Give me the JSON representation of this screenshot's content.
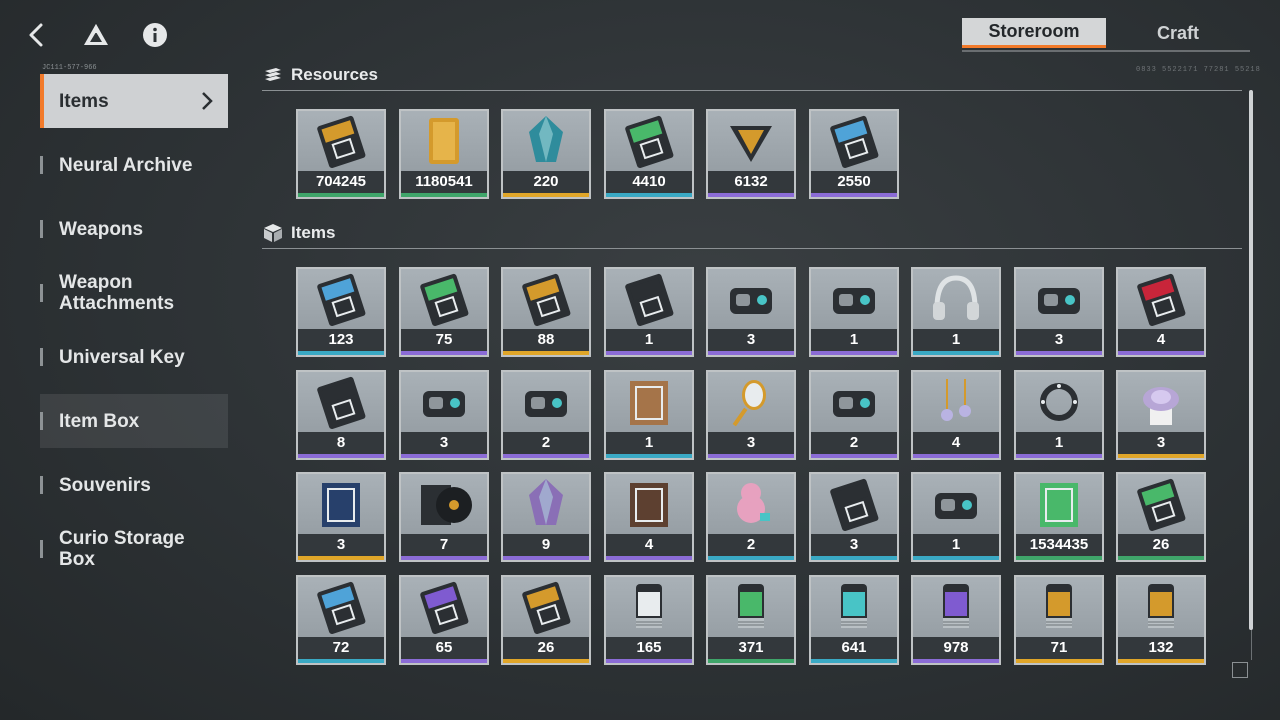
{
  "header": {
    "back_icon": "back-chevron-icon",
    "logo_icon": "triangle-logo-icon",
    "info_icon": "info-icon",
    "tabs": [
      {
        "label": "Storeroom",
        "active": true
      },
      {
        "label": "Craft",
        "active": false
      }
    ]
  },
  "serials": {
    "left": "JC111-577-966",
    "right": "0833 5522171 77281 55218"
  },
  "sidebar": {
    "items": [
      {
        "label": "Items",
        "selected": true
      },
      {
        "label": "Neural Archive"
      },
      {
        "label": "Weapons"
      },
      {
        "label": "Weapon Attachments"
      },
      {
        "label": "Universal Key"
      },
      {
        "label": "Item Box",
        "highlighted": true
      },
      {
        "label": "Souvenirs"
      },
      {
        "label": "Curio Storage Box"
      }
    ]
  },
  "colors": {
    "accent": "#f27a2a",
    "rarity_green": "#3fa56a",
    "rarity_gold": "#e0a629",
    "rarity_blue": "#3aa9c4",
    "rarity_purple": "#8b6cd6"
  },
  "resources": {
    "title": "Resources",
    "items": [
      {
        "qty": "704245",
        "rarity": "green",
        "icon": "gold-ticket-icon"
      },
      {
        "qty": "1180541",
        "rarity": "green",
        "icon": "gold-bar-icon"
      },
      {
        "qty": "220",
        "rarity": "gold",
        "icon": "crystal-gem-icon"
      },
      {
        "qty": "4410",
        "rarity": "blue",
        "icon": "green-ticket-icon"
      },
      {
        "qty": "6132",
        "rarity": "purple",
        "icon": "triangle-token-icon"
      },
      {
        "qty": "2550",
        "rarity": "purple",
        "icon": "blue-card-icon"
      }
    ]
  },
  "items": {
    "title": "Items",
    "rows": [
      [
        {
          "qty": "123",
          "rarity": "blue",
          "icon": "blue-chip-card-icon"
        },
        {
          "qty": "75",
          "rarity": "purple",
          "icon": "green-chip-card-icon"
        },
        {
          "qty": "88",
          "rarity": "gold",
          "icon": "gold-chip-card-icon"
        },
        {
          "qty": "1",
          "rarity": "purple",
          "icon": "black-card-icon"
        },
        {
          "qty": "3",
          "rarity": "purple",
          "icon": "camcorder-icon"
        },
        {
          "qty": "1",
          "rarity": "purple",
          "icon": "vr-headset-icon"
        },
        {
          "qty": "1",
          "rarity": "blue",
          "icon": "headphones-icon"
        },
        {
          "qty": "3",
          "rarity": "purple",
          "icon": "armored-vehicle-icon"
        },
        {
          "qty": "4",
          "rarity": "purple",
          "icon": "coupon-icon"
        }
      ],
      [
        {
          "qty": "8",
          "rarity": "purple",
          "icon": "tickets-icon"
        },
        {
          "qty": "3",
          "rarity": "purple",
          "icon": "toolbox-icon"
        },
        {
          "qty": "2",
          "rarity": "purple",
          "icon": "robot-plush-icon"
        },
        {
          "qty": "1",
          "rarity": "blue",
          "icon": "cookie-box-icon"
        },
        {
          "qty": "3",
          "rarity": "purple",
          "icon": "hand-mirror-icon"
        },
        {
          "qty": "2",
          "rarity": "purple",
          "icon": "power-bank-icon"
        },
        {
          "qty": "4",
          "rarity": "purple",
          "icon": "earrings-icon"
        },
        {
          "qty": "1",
          "rarity": "purple",
          "icon": "spiked-collar-icon"
        },
        {
          "qty": "3",
          "rarity": "gold",
          "icon": "succulent-icon"
        }
      ],
      [
        {
          "qty": "3",
          "rarity": "gold",
          "icon": "blue-book-icon"
        },
        {
          "qty": "7",
          "rarity": "purple",
          "icon": "vinyl-record-icon"
        },
        {
          "qty": "9",
          "rarity": "purple",
          "icon": "amethyst-icon"
        },
        {
          "qty": "4",
          "rarity": "purple",
          "icon": "picture-frame-icon"
        },
        {
          "qty": "2",
          "rarity": "blue",
          "icon": "pink-toy-icon"
        },
        {
          "qty": "3",
          "rarity": "blue",
          "icon": "tree-postcard-icon"
        },
        {
          "qty": "1",
          "rarity": "blue",
          "icon": "figurine-icon"
        },
        {
          "qty": "1534435",
          "rarity": "green",
          "icon": "data-terminal-icon"
        },
        {
          "qty": "26",
          "rarity": "green",
          "icon": "green-keycard-icon"
        }
      ],
      [
        {
          "qty": "72",
          "rarity": "blue",
          "icon": "blue-keycard-icon"
        },
        {
          "qty": "65",
          "rarity": "purple",
          "icon": "purple-keycard-icon"
        },
        {
          "qty": "26",
          "rarity": "gold",
          "icon": "gold-purple-keycard-icon"
        },
        {
          "qty": "165",
          "rarity": "purple",
          "icon": "grey-canister-icon"
        },
        {
          "qty": "371",
          "rarity": "green",
          "icon": "green-canister-icon"
        },
        {
          "qty": "641",
          "rarity": "blue",
          "icon": "blue-canister-icon"
        },
        {
          "qty": "978",
          "rarity": "purple",
          "icon": "purple-canister-icon"
        },
        {
          "qty": "71",
          "rarity": "gold",
          "icon": "gold-canister-icon"
        },
        {
          "qty": "132",
          "rarity": "gold",
          "icon": "gold-canister-b-icon"
        }
      ]
    ]
  }
}
